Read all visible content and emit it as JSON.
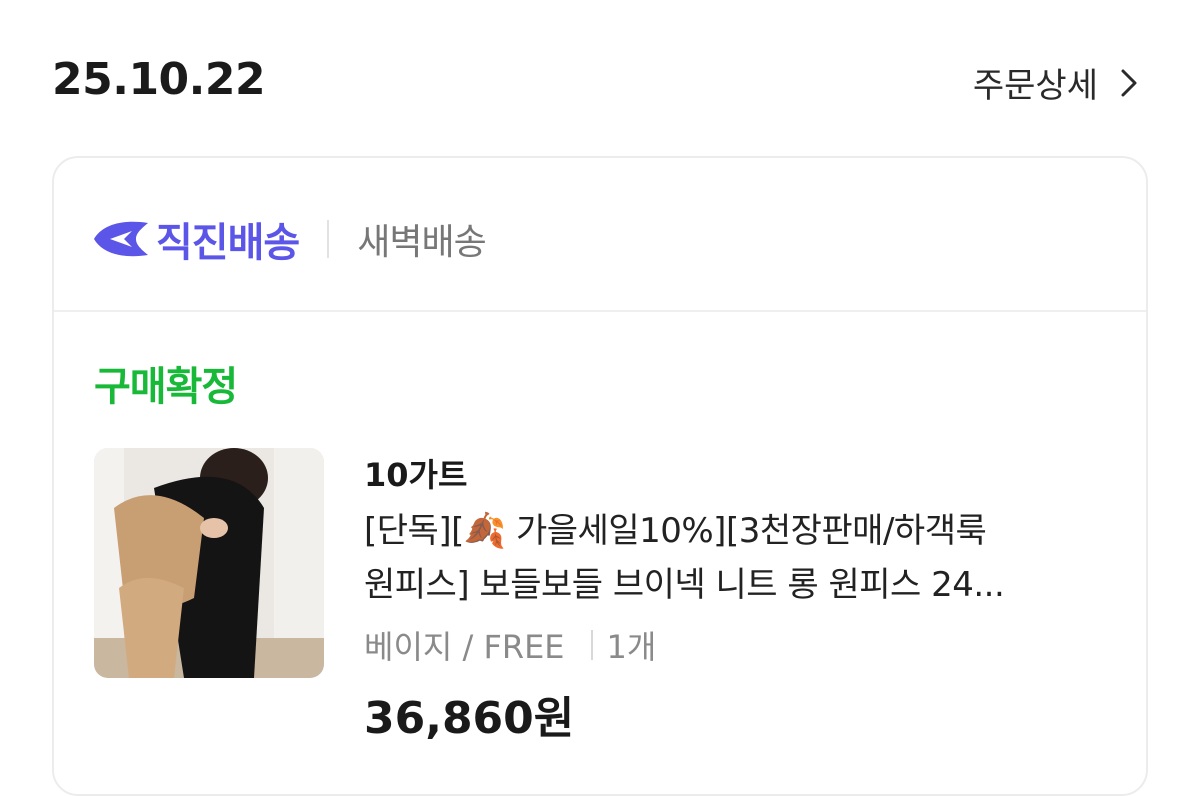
{
  "order": {
    "date": "25.10.22",
    "detail_label": "주문상세"
  },
  "delivery": {
    "brand_label": "직진배송",
    "type_label": "새벽배송"
  },
  "status": "구매확정",
  "item": {
    "seller": "10가트",
    "title_line1": "[단독][🍂 가을세일10%][3천장판매/하객룩",
    "title_line2": "원피스] 보들보들 브이넥 니트 롱 원피스 24...",
    "option": "베이지 / FREE",
    "quantity": "1개",
    "price": "36,860원"
  },
  "colors": {
    "brand": "#5b55e8",
    "status": "#18b838"
  },
  "icons": {
    "logo": "delivery-arrow-icon",
    "chevron": "chevron-right-icon"
  }
}
